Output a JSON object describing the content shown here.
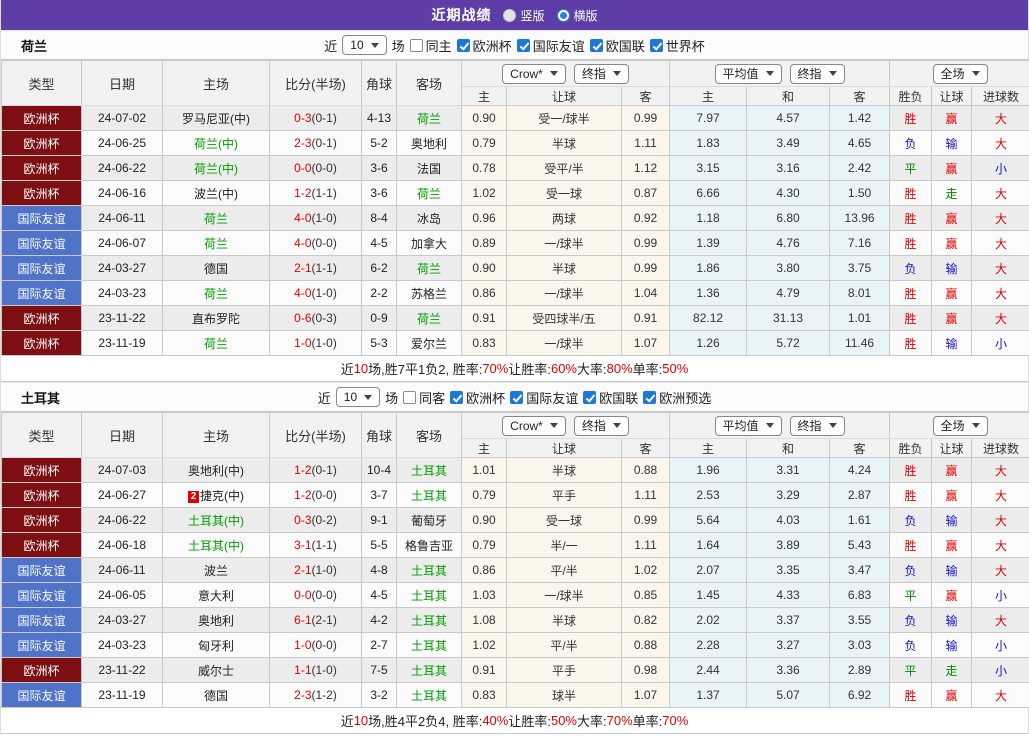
{
  "title_bar": {
    "title": "近期战绩",
    "radio_vertical": "竖版",
    "radio_horizontal": "横版"
  },
  "colors": {
    "titlebar_purple": "#5c3ea6",
    "euro_maroon": "#7d0e11",
    "friendly_blue": "#4f73c9",
    "team_green": "#00a000",
    "result_red": "#e60000",
    "result_blue": "#1515cc",
    "result_green": "#028a02",
    "odds_bg": "#fbf6ec",
    "avg_bg": "#e9f3fa",
    "check_blue": "#1e78d7"
  },
  "color_maps": {
    "result": {
      "胜": "red",
      "平": "green",
      "负": "blue",
      "赢": "red",
      "走": "green",
      "输": "blue",
      "大": "red",
      "小": "blue"
    },
    "competition": {
      "欧洲杯": "euro",
      "国际友谊": "friendly"
    }
  },
  "table_header": {
    "cols": [
      "类型",
      "日期",
      "主场",
      "比分(半场)",
      "角球",
      "客场"
    ],
    "sub": [
      "主",
      "让球",
      "客",
      "主",
      "和",
      "客",
      "胜负",
      "让球",
      "进球数"
    ],
    "selects": {
      "odds_source": "Crow*",
      "odds_stage": "终指",
      "avg_source": "平均值",
      "avg_stage": "终指",
      "scope": "全场"
    }
  },
  "sections": [
    {
      "team": "荷兰",
      "filter": {
        "near": "近",
        "count": "10",
        "unit": "场",
        "same": {
          "label": "同主",
          "checked": false
        },
        "competitions": [
          {
            "label": "欧洲杯",
            "checked": true
          },
          {
            "label": "国际友谊",
            "checked": true
          },
          {
            "label": "欧国联",
            "checked": true
          },
          {
            "label": "世界杯",
            "checked": true
          }
        ]
      },
      "rows": [
        {
          "comp": "欧洲杯",
          "date": "24-07-02",
          "home": "罗马尼亚(中)",
          "home_green": false,
          "badge": "",
          "score": "0-3",
          "half": "(0-1)",
          "corner": "4-13",
          "away": "荷兰",
          "away_green": true,
          "o_home": "0.90",
          "handicap": "受一/球半",
          "o_away": "0.99",
          "avg_home": "7.97",
          "avg_draw": "4.57",
          "avg_away": "1.42",
          "res": "胜",
          "hres": "赢",
          "gres": "大"
        },
        {
          "comp": "欧洲杯",
          "date": "24-06-25",
          "home": "荷兰(中)",
          "home_green": true,
          "badge": "",
          "score": "2-3",
          "half": "(0-1)",
          "corner": "5-2",
          "away": "奥地利",
          "away_green": false,
          "o_home": "0.79",
          "handicap": "半球",
          "o_away": "1.11",
          "avg_home": "1.83",
          "avg_draw": "3.49",
          "avg_away": "4.65",
          "res": "负",
          "hres": "输",
          "gres": "大"
        },
        {
          "comp": "欧洲杯",
          "date": "24-06-22",
          "home": "荷兰(中)",
          "home_green": true,
          "badge": "",
          "score": "0-0",
          "half": "(0-0)",
          "corner": "3-6",
          "away": "法国",
          "away_green": false,
          "o_home": "0.78",
          "handicap": "受平/半",
          "o_away": "1.12",
          "avg_home": "3.15",
          "avg_draw": "3.16",
          "avg_away": "2.42",
          "res": "平",
          "hres": "赢",
          "gres": "小"
        },
        {
          "comp": "欧洲杯",
          "date": "24-06-16",
          "home": "波兰(中)",
          "home_green": false,
          "badge": "",
          "score": "1-2",
          "half": "(1-1)",
          "corner": "3-6",
          "away": "荷兰",
          "away_green": true,
          "o_home": "1.02",
          "handicap": "受一球",
          "o_away": "0.87",
          "avg_home": "6.66",
          "avg_draw": "4.30",
          "avg_away": "1.50",
          "res": "胜",
          "hres": "走",
          "gres": "大"
        },
        {
          "comp": "国际友谊",
          "date": "24-06-11",
          "home": "荷兰",
          "home_green": true,
          "badge": "",
          "score": "4-0",
          "half": "(1-0)",
          "corner": "8-4",
          "away": "冰岛",
          "away_green": false,
          "o_home": "0.96",
          "handicap": "两球",
          "o_away": "0.92",
          "avg_home": "1.18",
          "avg_draw": "6.80",
          "avg_away": "13.96",
          "res": "胜",
          "hres": "赢",
          "gres": "大"
        },
        {
          "comp": "国际友谊",
          "date": "24-06-07",
          "home": "荷兰",
          "home_green": true,
          "badge": "",
          "score": "4-0",
          "half": "(0-0)",
          "corner": "4-5",
          "away": "加拿大",
          "away_green": false,
          "o_home": "0.89",
          "handicap": "一/球半",
          "o_away": "0.99",
          "avg_home": "1.39",
          "avg_draw": "4.76",
          "avg_away": "7.16",
          "res": "胜",
          "hres": "赢",
          "gres": "大"
        },
        {
          "comp": "国际友谊",
          "date": "24-03-27",
          "home": "德国",
          "home_green": false,
          "badge": "",
          "score": "2-1",
          "half": "(1-1)",
          "corner": "6-2",
          "away": "荷兰",
          "away_green": true,
          "o_home": "0.90",
          "handicap": "半球",
          "o_away": "0.99",
          "avg_home": "1.86",
          "avg_draw": "3.80",
          "avg_away": "3.75",
          "res": "负",
          "hres": "输",
          "gres": "大"
        },
        {
          "comp": "国际友谊",
          "date": "24-03-23",
          "home": "荷兰",
          "home_green": true,
          "badge": "",
          "score": "4-0",
          "half": "(1-0)",
          "corner": "2-2",
          "away": "苏格兰",
          "away_green": false,
          "o_home": "0.86",
          "handicap": "一/球半",
          "o_away": "1.04",
          "avg_home": "1.36",
          "avg_draw": "4.79",
          "avg_away": "8.01",
          "res": "胜",
          "hres": "赢",
          "gres": "大"
        },
        {
          "comp": "欧洲杯",
          "date": "23-11-22",
          "home": "直布罗陀",
          "home_green": false,
          "badge": "",
          "score": "0-6",
          "half": "(0-3)",
          "corner": "0-9",
          "away": "荷兰",
          "away_green": true,
          "o_home": "0.91",
          "handicap": "受四球半/五",
          "o_away": "0.91",
          "avg_home": "82.12",
          "avg_draw": "31.13",
          "avg_away": "1.01",
          "res": "胜",
          "hres": "赢",
          "gres": "大"
        },
        {
          "comp": "欧洲杯",
          "date": "23-11-19",
          "home": "荷兰",
          "home_green": true,
          "badge": "",
          "score": "1-0",
          "half": "(1-0)",
          "corner": "5-3",
          "away": "爱尔兰",
          "away_green": false,
          "o_home": "0.83",
          "handicap": "一/球半",
          "o_away": "1.07",
          "avg_home": "1.26",
          "avg_draw": "5.72",
          "avg_away": "11.46",
          "res": "胜",
          "hres": "输",
          "gres": "小"
        }
      ],
      "summary": [
        {
          "text": "近",
          "red": false
        },
        {
          "text": "10",
          "red": true
        },
        {
          "text": "场,胜7平1负2, 胜率:",
          "red": false
        },
        {
          "text": "70%",
          "red": true
        },
        {
          "text": " 让胜率:",
          "red": false
        },
        {
          "text": "60%",
          "red": true
        },
        {
          "text": " 大率:",
          "red": false
        },
        {
          "text": "80%",
          "red": true
        },
        {
          "text": " 单率:",
          "red": false
        },
        {
          "text": "50%",
          "red": true
        }
      ]
    },
    {
      "team": "土耳其",
      "filter": {
        "near": "近",
        "count": "10",
        "unit": "场",
        "same": {
          "label": "同客",
          "checked": false
        },
        "competitions": [
          {
            "label": "欧洲杯",
            "checked": true
          },
          {
            "label": "国际友谊",
            "checked": true
          },
          {
            "label": "欧国联",
            "checked": true
          },
          {
            "label": "欧洲预选",
            "checked": true
          }
        ]
      },
      "rows": [
        {
          "comp": "欧洲杯",
          "date": "24-07-03",
          "home": "奥地利(中)",
          "home_green": false,
          "badge": "",
          "score": "1-2",
          "half": "(0-1)",
          "corner": "10-4",
          "away": "土耳其",
          "away_green": true,
          "o_home": "1.01",
          "handicap": "半球",
          "o_away": "0.88",
          "avg_home": "1.96",
          "avg_draw": "3.31",
          "avg_away": "4.24",
          "res": "胜",
          "hres": "赢",
          "gres": "大"
        },
        {
          "comp": "欧洲杯",
          "date": "24-06-27",
          "home": "捷克(中)",
          "home_green": false,
          "badge": "2",
          "score": "1-2",
          "half": "(0-0)",
          "corner": "3-7",
          "away": "土耳其",
          "away_green": true,
          "o_home": "0.79",
          "handicap": "平手",
          "o_away": "1.11",
          "avg_home": "2.53",
          "avg_draw": "3.29",
          "avg_away": "2.87",
          "res": "胜",
          "hres": "赢",
          "gres": "大"
        },
        {
          "comp": "欧洲杯",
          "date": "24-06-22",
          "home": "土耳其(中)",
          "home_green": true,
          "badge": "",
          "score": "0-3",
          "half": "(0-2)",
          "corner": "9-1",
          "away": "葡萄牙",
          "away_green": false,
          "o_home": "0.90",
          "handicap": "受一球",
          "o_away": "0.99",
          "avg_home": "5.64",
          "avg_draw": "4.03",
          "avg_away": "1.61",
          "res": "负",
          "hres": "输",
          "gres": "大"
        },
        {
          "comp": "欧洲杯",
          "date": "24-06-18",
          "home": "土耳其(中)",
          "home_green": true,
          "badge": "",
          "score": "3-1",
          "half": "(1-1)",
          "corner": "5-5",
          "away": "格鲁吉亚",
          "away_green": false,
          "o_home": "0.79",
          "handicap": "半/一",
          "o_away": "1.11",
          "avg_home": "1.64",
          "avg_draw": "3.89",
          "avg_away": "5.43",
          "res": "胜",
          "hres": "赢",
          "gres": "大"
        },
        {
          "comp": "国际友谊",
          "date": "24-06-11",
          "home": "波兰",
          "home_green": false,
          "badge": "",
          "score": "2-1",
          "half": "(1-0)",
          "corner": "4-8",
          "away": "土耳其",
          "away_green": true,
          "o_home": "0.86",
          "handicap": "平/半",
          "o_away": "1.02",
          "avg_home": "2.07",
          "avg_draw": "3.35",
          "avg_away": "3.47",
          "res": "负",
          "hres": "输",
          "gres": "大"
        },
        {
          "comp": "国际友谊",
          "date": "24-06-05",
          "home": "意大利",
          "home_green": false,
          "badge": "",
          "score": "0-0",
          "half": "(0-0)",
          "corner": "4-5",
          "away": "土耳其",
          "away_green": true,
          "o_home": "1.03",
          "handicap": "一/球半",
          "o_away": "0.85",
          "avg_home": "1.45",
          "avg_draw": "4.33",
          "avg_away": "6.83",
          "res": "平",
          "hres": "赢",
          "gres": "小"
        },
        {
          "comp": "国际友谊",
          "date": "24-03-27",
          "home": "奥地利",
          "home_green": false,
          "badge": "",
          "score": "6-1",
          "half": "(2-1)",
          "corner": "4-2",
          "away": "土耳其",
          "away_green": true,
          "o_home": "1.08",
          "handicap": "半球",
          "o_away": "0.82",
          "avg_home": "2.02",
          "avg_draw": "3.37",
          "avg_away": "3.55",
          "res": "负",
          "hres": "输",
          "gres": "大"
        },
        {
          "comp": "国际友谊",
          "date": "24-03-23",
          "home": "匈牙利",
          "home_green": false,
          "badge": "",
          "score": "1-0",
          "half": "(0-0)",
          "corner": "2-7",
          "away": "土耳其",
          "away_green": true,
          "o_home": "1.02",
          "handicap": "平/半",
          "o_away": "0.88",
          "avg_home": "2.28",
          "avg_draw": "3.27",
          "avg_away": "3.03",
          "res": "负",
          "hres": "输",
          "gres": "小"
        },
        {
          "comp": "欧洲杯",
          "date": "23-11-22",
          "home": "威尔士",
          "home_green": false,
          "badge": "",
          "score": "1-1",
          "half": "(1-0)",
          "corner": "7-5",
          "away": "土耳其",
          "away_green": true,
          "o_home": "0.91",
          "handicap": "平手",
          "o_away": "0.98",
          "avg_home": "2.44",
          "avg_draw": "3.36",
          "avg_away": "2.89",
          "res": "平",
          "hres": "走",
          "gres": "小"
        },
        {
          "comp": "国际友谊",
          "date": "23-11-19",
          "home": "德国",
          "home_green": false,
          "badge": "",
          "score": "2-3",
          "half": "(1-2)",
          "corner": "3-2",
          "away": "土耳其",
          "away_green": true,
          "o_home": "0.83",
          "handicap": "球半",
          "o_away": "1.07",
          "avg_home": "1.37",
          "avg_draw": "5.07",
          "avg_away": "6.92",
          "res": "胜",
          "hres": "赢",
          "gres": "大"
        }
      ],
      "summary": [
        {
          "text": "近",
          "red": false
        },
        {
          "text": "10",
          "red": true
        },
        {
          "text": "场,胜4平2负4, 胜率:",
          "red": false
        },
        {
          "text": "40%",
          "red": true
        },
        {
          "text": " 让胜率:",
          "red": false
        },
        {
          "text": "50%",
          "red": true
        },
        {
          "text": " 大率:",
          "red": false
        },
        {
          "text": "70%",
          "red": true
        },
        {
          "text": " 单率:",
          "red": false
        },
        {
          "text": "70%",
          "red": true
        }
      ]
    }
  ]
}
